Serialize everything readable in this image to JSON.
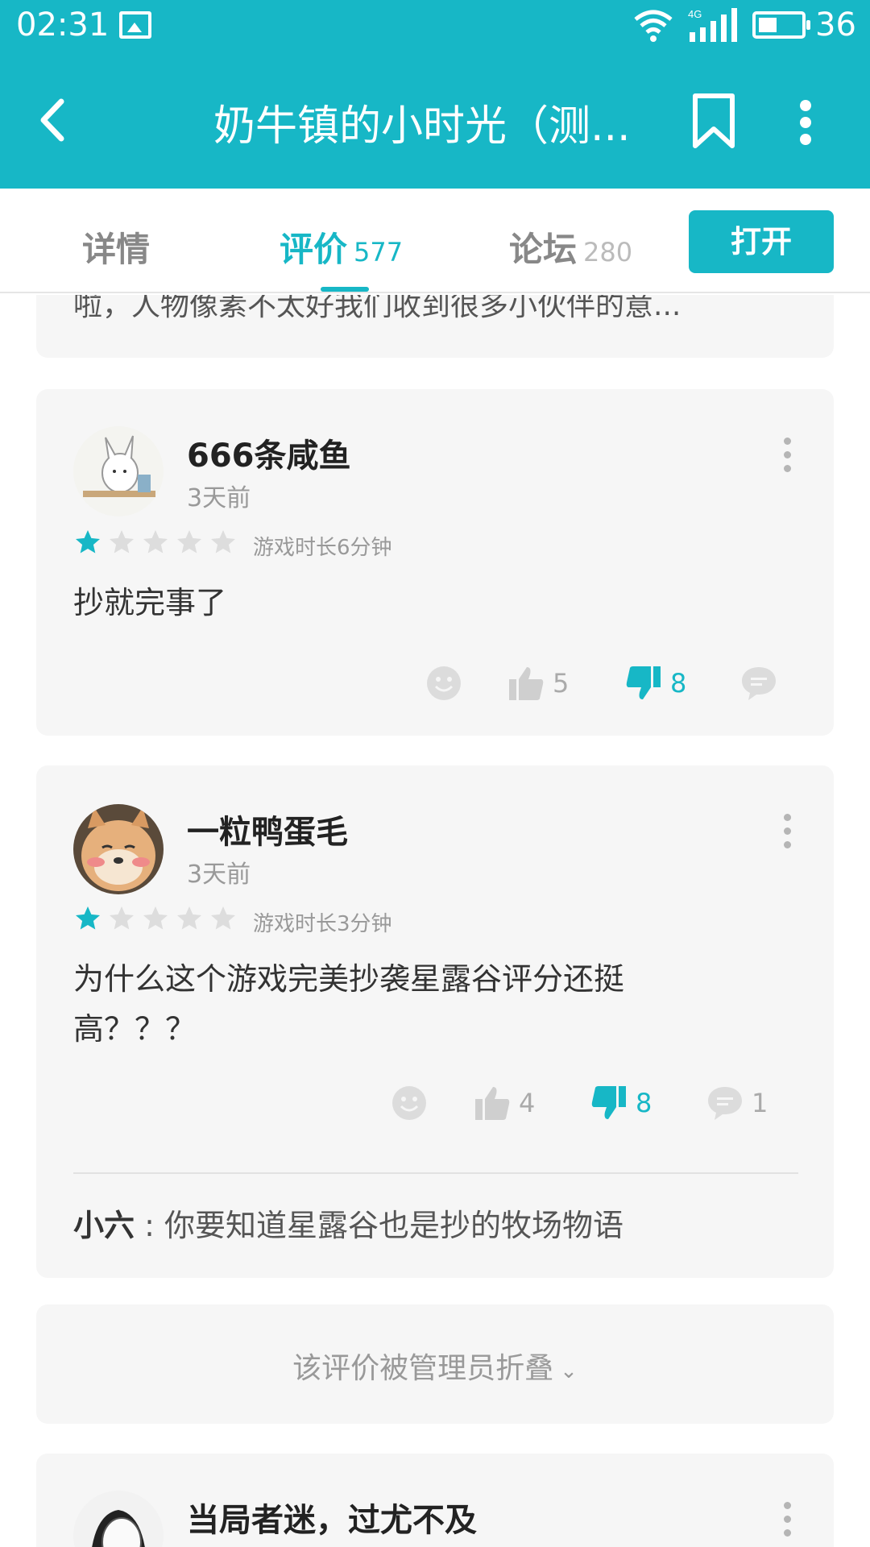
{
  "status_bar": {
    "time": "02:31",
    "battery_level": "36",
    "network_label": "4G"
  },
  "app_bar": {
    "title": "奶牛镇的小时光（测...",
    "icons": [
      "back-arrow-icon",
      "bookmark-icon",
      "more-vertical-icon"
    ]
  },
  "tabs": [
    {
      "label": "详情",
      "count": ""
    },
    {
      "label": "评价",
      "count": "577"
    },
    {
      "label": "论坛",
      "count": "280"
    }
  ],
  "active_tab": "评价",
  "open_button": {
    "label": "打开"
  },
  "accent_color": "#17b7c6",
  "partial_review": {
    "text": "啦，人物像素不太好我们收到很多小伙伴的意..."
  },
  "reviews": [
    {
      "username": "666条咸鱼",
      "time": "3天前",
      "rating": 1,
      "play_time": "游戏时长6分钟",
      "text": "抄就完事了",
      "likes": "5",
      "dislikes": "8",
      "comments": ""
    },
    {
      "username": "一粒鸭蛋毛",
      "time": "3天前",
      "rating": 1,
      "play_time": "游戏时长3分钟",
      "text": "为什么这个游戏完美抄袭星露谷评分还挺高？？？",
      "likes": "4",
      "dislikes": "8",
      "comments": "1",
      "reply": {
        "name": "小六",
        "separator": " : ",
        "text": "你要知道星露谷也是抄的牧场物语"
      }
    }
  ],
  "folded_notice": {
    "text": "该评价被管理员折叠"
  },
  "next_review": {
    "username": "当局者迷，过尤不及"
  }
}
